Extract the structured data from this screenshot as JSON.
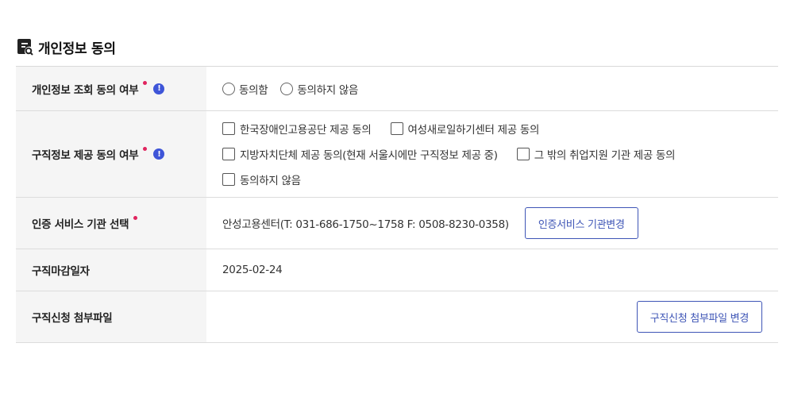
{
  "section": {
    "title": "개인정보 동의",
    "icon": "document-search-icon"
  },
  "rows": {
    "privacy_consent": {
      "label": "개인정보 조회 동의 여부",
      "options": [
        "동의함",
        "동의하지 않음"
      ]
    },
    "jobinfo_consent": {
      "label": "구직정보 제공 동의 여부",
      "options": [
        "한국장애인고용공단 제공 동의",
        "여성새로일하기센터 제공 동의",
        "지방자치단체 제공 동의(현재 서울시에만 구직정보 제공 중)",
        "그 밖의 취업지원 기관 제공 동의",
        "동의하지 않음"
      ]
    },
    "cert_service": {
      "label": "인증 서비스 기관 선택",
      "value": "안성고용센터(T: 031-686-1750~1758 F: 0508-8230-0358)",
      "button": "인증서비스 기관변경"
    },
    "deadline": {
      "label": "구직마감일자",
      "value": "2025-02-24"
    },
    "attachment": {
      "label": "구직신청 첨부파일",
      "button": "구직신청 첨부파일 변경"
    }
  },
  "colors": {
    "accent": "#3e55b6",
    "required": "#e0245e",
    "info": "#3e55d8",
    "label_bg": "#f5f5f5"
  },
  "info_icon_glyph": "!"
}
